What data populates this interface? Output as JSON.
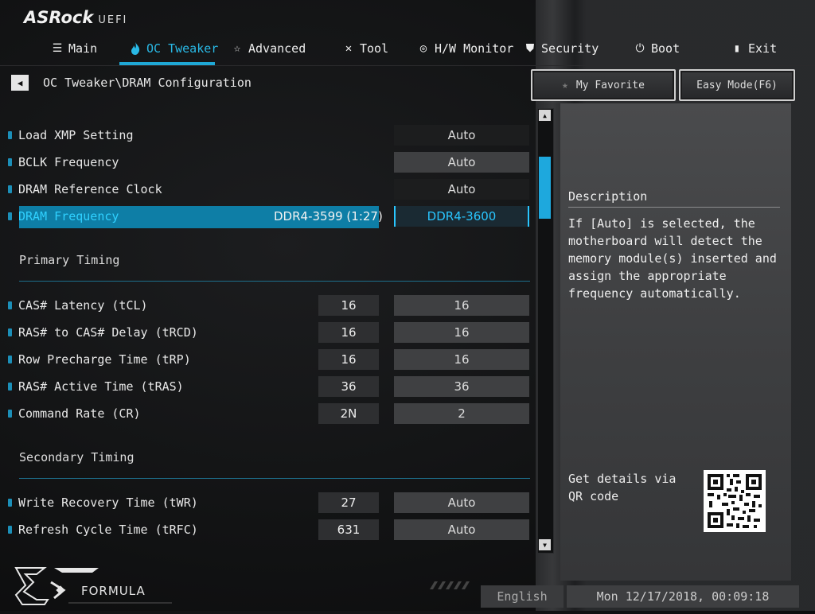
{
  "brand": {
    "name": "ASRock",
    "suffix": "UEFI"
  },
  "nav": [
    {
      "label": "Main",
      "icon": "list-icon"
    },
    {
      "label": "OC Tweaker",
      "icon": "flame-icon",
      "active": true
    },
    {
      "label": "Advanced",
      "icon": "star-icon"
    },
    {
      "label": "Tool",
      "icon": "tools-icon"
    },
    {
      "label": "H/W Monitor",
      "icon": "monitor-icon"
    },
    {
      "label": "Security",
      "icon": "shield-icon"
    },
    {
      "label": "Boot",
      "icon": "power-icon"
    },
    {
      "label": "Exit",
      "icon": "exit-icon"
    }
  ],
  "breadcrumb": "OC Tweaker\\DRAM Configuration",
  "header_buttons": {
    "favorite": "My Favorite",
    "easy_mode": "Easy Mode(F6)"
  },
  "settings": [
    {
      "label": "Load XMP Setting",
      "value": "Auto"
    },
    {
      "label": "BCLK Frequency",
      "value": "Auto"
    },
    {
      "label": "DRAM Reference Clock",
      "value": "Auto"
    },
    {
      "label": "DRAM Frequency",
      "current": "DDR4-3599 (1:27)",
      "value": "DDR4-3600"
    }
  ],
  "primary_timing": {
    "title": "Primary Timing",
    "rows": [
      {
        "label": "CAS# Latency (tCL)",
        "current": "16",
        "value": "16"
      },
      {
        "label": "RAS# to CAS# Delay (tRCD)",
        "current": "16",
        "value": "16"
      },
      {
        "label": "Row Precharge Time (tRP)",
        "current": "16",
        "value": "16"
      },
      {
        "label": "RAS# Active Time (tRAS)",
        "current": "36",
        "value": "36"
      },
      {
        "label": "Command Rate (CR)",
        "current": "2N",
        "value": "2"
      }
    ]
  },
  "secondary_timing": {
    "title": "Secondary Timing",
    "rows": [
      {
        "label": "Write Recovery Time (tWR)",
        "current": "27",
        "value": "Auto"
      },
      {
        "label": "Refresh Cycle Time (tRFC)",
        "current": "631",
        "value": "Auto"
      }
    ]
  },
  "description": {
    "title": "Description",
    "text": "If [Auto] is selected, the motherboard will detect the memory module(s) inserted and assign the appropriate frequency automatically.",
    "qr_text": "Get details via QR code"
  },
  "footer": {
    "language": "English",
    "datetime": "Mon 12/17/2018, 00:09:18",
    "logo_text": "FORMULA"
  },
  "colors": {
    "accent": "#1fa8d6",
    "selected_row": "#0e7ea6"
  }
}
